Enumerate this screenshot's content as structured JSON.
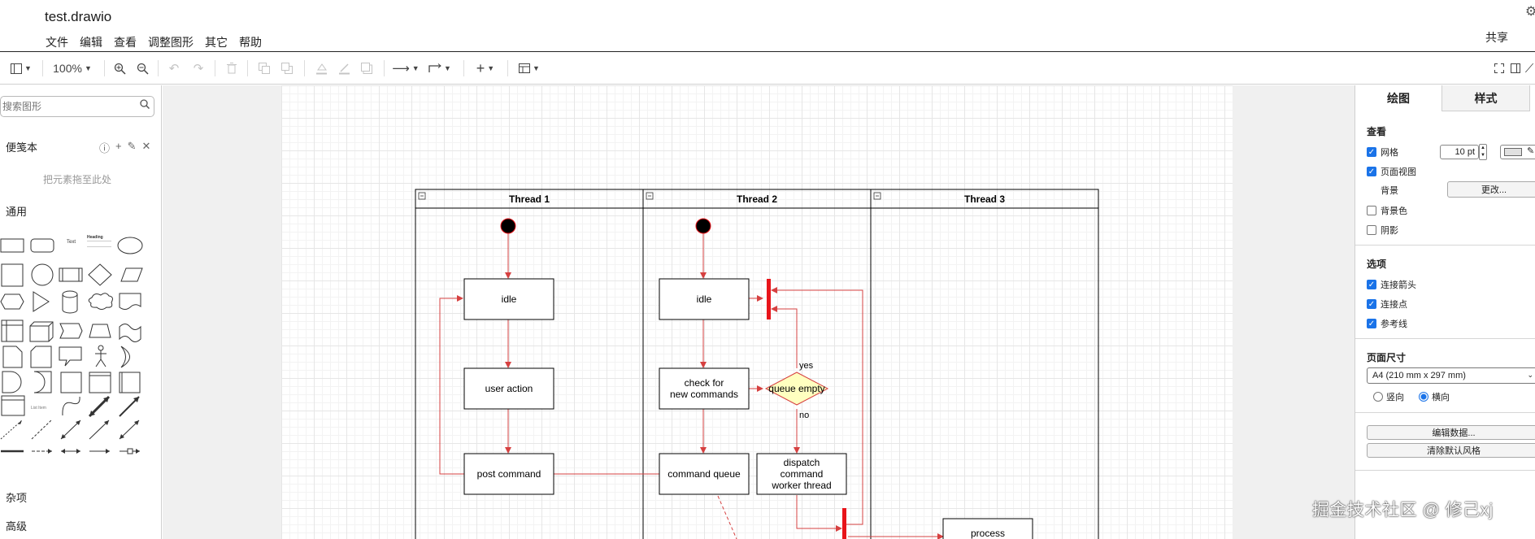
{
  "app": {
    "title": "test.drawio",
    "share_label": "共享"
  },
  "menu": {
    "items": [
      "文件",
      "编辑",
      "查看",
      "调整图形",
      "其它",
      "帮助"
    ]
  },
  "toolbar": {
    "zoom": "100%"
  },
  "sidebar": {
    "search_placeholder": "搜索图形",
    "scratchpad_title": "便笺本",
    "scratchpad_hint": "把元素拖至此处",
    "general_title": "通用",
    "misc_title": "杂项",
    "advanced_title": "高级",
    "shape_text_label": "Text",
    "shape_heading_label": "Heading",
    "shape_list_label": "List Item"
  },
  "diagram": {
    "lanes": [
      {
        "title": "Thread 1"
      },
      {
        "title": "Thread 2"
      },
      {
        "title": "Thread 3"
      }
    ],
    "nodes": {
      "idle1": "idle",
      "user_action": "user action",
      "post_command": "post command",
      "idle2": "idle",
      "check_line1": "check for",
      "check_line2": "new commands",
      "queue_empty": "queue empty",
      "command_queue": "command queue",
      "dispatch_line1": "dispatch",
      "dispatch_line2": "command",
      "dispatch_line3": "worker thread",
      "process": "process"
    },
    "edge_labels": {
      "yes": "yes",
      "no": "no"
    },
    "colors": {
      "edge": "#d64040",
      "bar": "#e8141a",
      "start_fill": "#000000",
      "start_stroke": "#e8141a",
      "decision_fill": "#ffffc0"
    }
  },
  "format_panel": {
    "tabs": [
      "绘图",
      "样式"
    ],
    "view_title": "查看",
    "grid_label": "网格",
    "grid_size": "10 pt",
    "page_view_label": "页面视图",
    "background_label": "背景",
    "change_button": "更改...",
    "background_color_label": "背景色",
    "shadow_label": "阴影",
    "options_title": "选项",
    "connection_arrows_label": "连接箭头",
    "connection_points_label": "连接点",
    "guides_label": "参考线",
    "page_size_title": "页面尺寸",
    "page_size_value": "A4 (210 mm x 297 mm)",
    "portrait_label": "竖向",
    "landscape_label": "横向",
    "edit_data_button": "编辑数据...",
    "clear_style_button": "清除默认风格"
  },
  "watermark": "掘金技术社区 @ 修己xj"
}
